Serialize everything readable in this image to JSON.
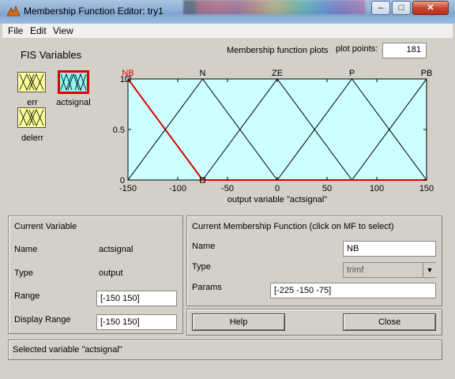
{
  "window": {
    "title": "Membership Function Editor: try1"
  },
  "menu": [
    "File",
    "Edit",
    "View"
  ],
  "fis": {
    "title": "FIS Variables",
    "variables": [
      {
        "label": "err"
      },
      {
        "label": "actsignal",
        "selected": true
      },
      {
        "label": "delerr"
      }
    ]
  },
  "plot": {
    "title": "Membership function plots",
    "points_label": "plot points:",
    "points_value": "181",
    "xlabel": "output variable \"actsignal\"",
    "selected_color": "#e00000",
    "bg_color": "#ccffff"
  },
  "chart_data": {
    "type": "line",
    "xlim": [
      -150,
      150
    ],
    "ylim": [
      0,
      1
    ],
    "x_ticks": [
      -150,
      -100,
      -50,
      0,
      50,
      100,
      150
    ],
    "y_ticks": [
      0,
      0.5,
      1
    ],
    "y_tick_labels": [
      "0",
      "0.5",
      "1"
    ],
    "series": [
      {
        "name": "NB",
        "points": [
          [
            -225,
            0
          ],
          [
            -150,
            1
          ],
          [
            -75,
            0
          ]
        ],
        "selected": true
      },
      {
        "name": "N",
        "points": [
          [
            -150,
            0
          ],
          [
            -75,
            1
          ],
          [
            0,
            0
          ]
        ]
      },
      {
        "name": "ZE",
        "points": [
          [
            -75,
            0
          ],
          [
            0,
            1
          ],
          [
            75,
            0
          ]
        ]
      },
      {
        "name": "P",
        "points": [
          [
            0,
            0
          ],
          [
            75,
            1
          ],
          [
            150,
            0
          ]
        ]
      },
      {
        "name": "PB",
        "points": [
          [
            75,
            0
          ],
          [
            150,
            1
          ],
          [
            225,
            0
          ]
        ]
      }
    ]
  },
  "current_variable": {
    "title": "Current Variable",
    "name_label": "Name",
    "name_value": "actsignal",
    "type_label": "Type",
    "type_value": "output",
    "range_label": "Range",
    "range_value": "[-150 150]",
    "display_range_label": "Display Range",
    "display_range_value": "[-150 150]"
  },
  "current_mf": {
    "title": "Current Membership Function (click on MF to select)",
    "name_label": "Name",
    "name_value": "NB",
    "type_label": "Type",
    "type_value": "trimf",
    "params_label": "Params",
    "params_value": "[-225 -150 -75]"
  },
  "buttons": {
    "help": "Help",
    "close": "Close"
  },
  "status": "Selected variable \"actsignal\"",
  "titlebar_buttons": {
    "min": "–",
    "max": "□",
    "close": "✕"
  }
}
